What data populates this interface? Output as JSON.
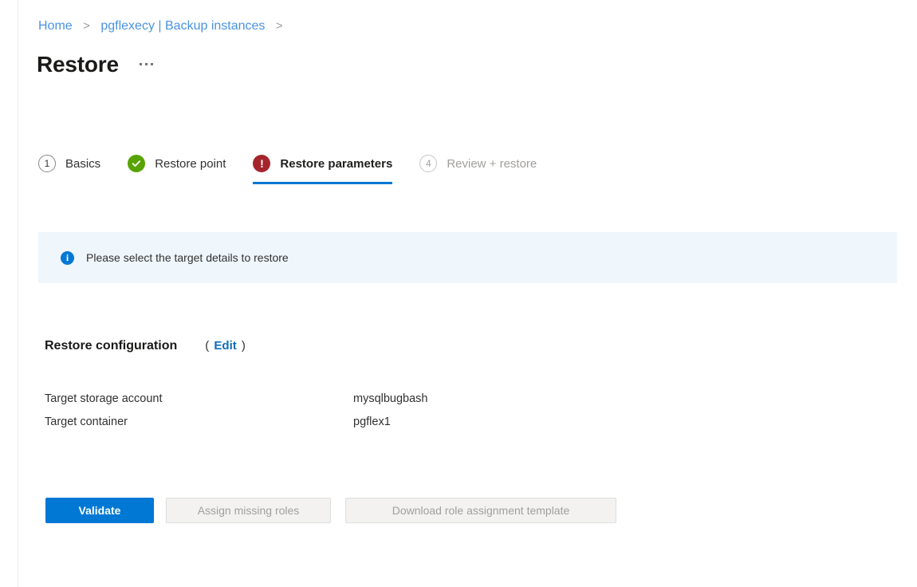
{
  "breadcrumb": {
    "items": [
      {
        "label": "Home",
        "separator": ">"
      },
      {
        "label": "pgflexecy | Backup instances",
        "separator": ">"
      }
    ],
    "sep1": ">",
    "sep2": ">"
  },
  "header": {
    "title": "Restore",
    "more_menu": "more-actions"
  },
  "wizard": {
    "steps": [
      {
        "badge": "1",
        "label": "Basics",
        "state": "pending",
        "icon": "number-circle-icon"
      },
      {
        "badge": "",
        "label": "Restore point",
        "state": "complete",
        "icon": "success-check-icon"
      },
      {
        "badge": "!",
        "label": "Restore parameters",
        "state": "error-active",
        "icon": "error-exclamation-icon"
      },
      {
        "badge": "4",
        "label": "Review + restore",
        "state": "disabled",
        "icon": "number-circle-icon"
      }
    ]
  },
  "banner": {
    "icon": "info-icon",
    "icon_glyph": "i",
    "message": "Please select the target details to restore",
    "background": "#eff6fc",
    "accent": "#0078d4"
  },
  "section": {
    "title": "Restore configuration",
    "paren_open": "(",
    "edit_label": "Edit",
    "paren_close": ")"
  },
  "details": {
    "rows": [
      {
        "label": "Target storage account",
        "value": "mysqlbugbash"
      },
      {
        "label": "Target container",
        "value": "pgflex1"
      }
    ]
  },
  "actions": {
    "validate": "Validate",
    "assign_missing_roles": "Assign missing roles",
    "download_template": "Download role assignment template"
  },
  "colors": {
    "primary": "#0078d4",
    "link": "#0f6cbd",
    "success": "#57a300",
    "error": "#a4262c",
    "disabled_text": "#a19f9d"
  }
}
